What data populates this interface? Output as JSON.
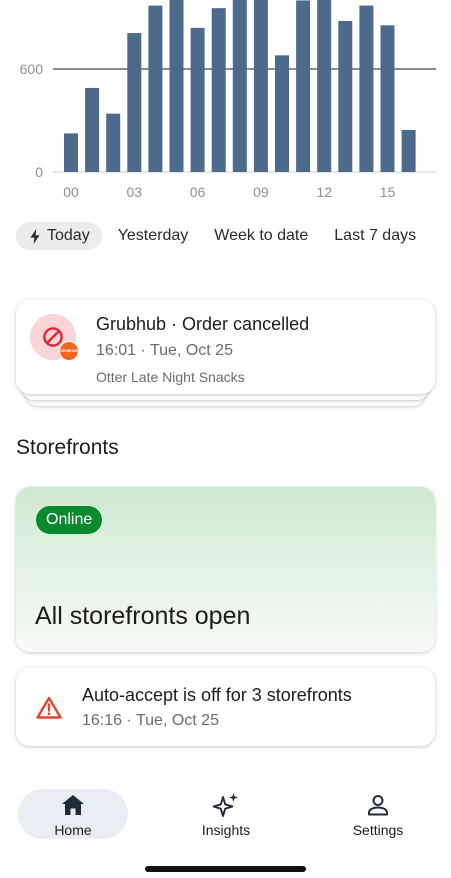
{
  "chart_data": {
    "type": "bar",
    "categories": [
      "00",
      "01",
      "02",
      "03",
      "04",
      "05",
      "06",
      "07",
      "08",
      "09",
      "10",
      "11",
      "12",
      "13",
      "14",
      "15",
      "16"
    ],
    "values": [
      225,
      490,
      340,
      810,
      970,
      1005,
      840,
      955,
      1040,
      1040,
      680,
      1000,
      1030,
      880,
      970,
      855,
      245
    ],
    "x_tick_labels": [
      "00",
      "03",
      "06",
      "09",
      "12",
      "15"
    ],
    "y_tick_labels": [
      "0",
      "600"
    ],
    "ylim": [
      0,
      1020
    ],
    "bar_color": "#4d6a8a",
    "grid": "y at 0 and 600",
    "title": "",
    "xlabel": "",
    "ylabel": ""
  },
  "range_tabs": [
    {
      "label": "Today",
      "active": true,
      "icon": "bolt-icon"
    },
    {
      "label": "Yesterday",
      "active": false
    },
    {
      "label": "Week to date",
      "active": false
    },
    {
      "label": "Last 7 days",
      "active": false
    }
  ],
  "order": {
    "title": "Grubhub · Order cancelled",
    "time": "16:01 · Tue, Oct 25",
    "store": "Otter Late Night Snacks",
    "brand_badge": "GRUBHUB",
    "icon": "cancel-icon",
    "accent": "#e0252f",
    "badge_color": "#f5661f"
  },
  "storefronts": {
    "section_title": "Storefronts",
    "status_badge": "Online",
    "status_text": "All storefronts open",
    "badge_color": "#0a8a2e"
  },
  "alert": {
    "title": "Auto-accept is off for 3 storefronts",
    "time": "16:16 · Tue, Oct 25",
    "icon": "warning-icon",
    "icon_color": "#e4442b"
  },
  "nav": {
    "home": "Home",
    "insights": "Insights",
    "settings": "Settings"
  }
}
